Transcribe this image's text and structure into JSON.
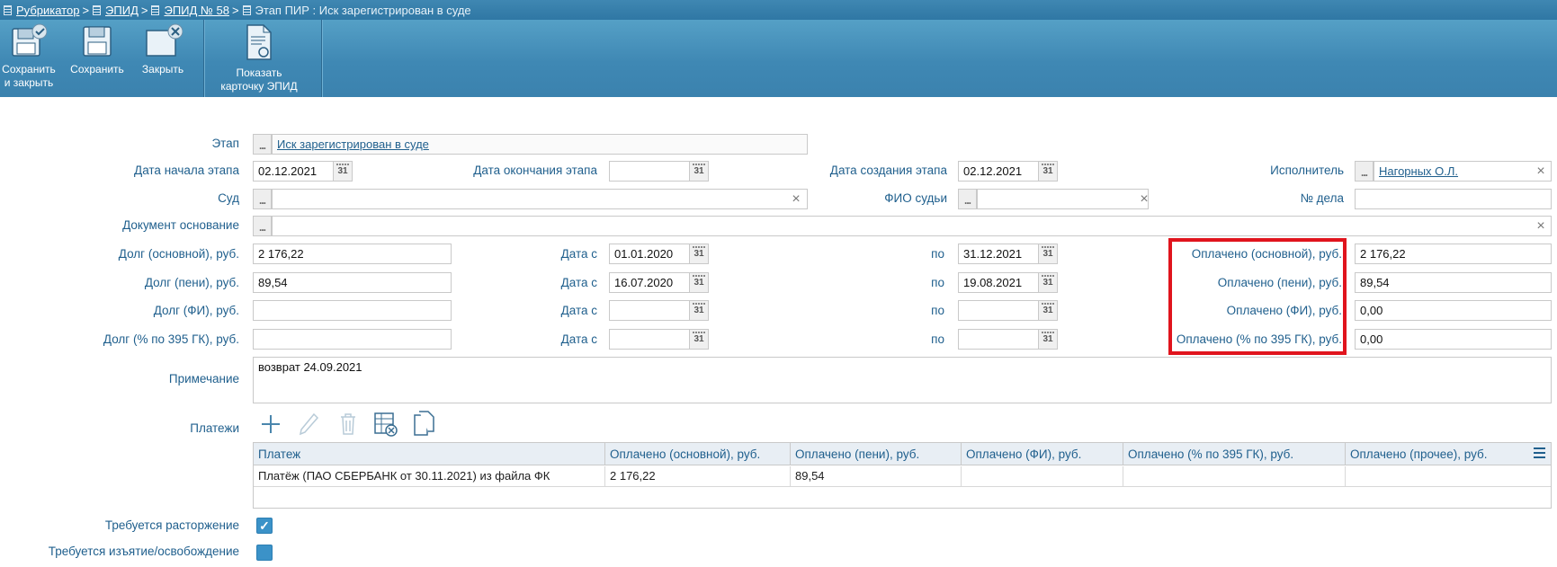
{
  "breadcrumb": {
    "items": [
      "Рубрикатор",
      "ЭПИД",
      "ЭПИД № 58"
    ],
    "current": "Этап ПИР : Иск зарегистрирован в суде",
    "separator": ">"
  },
  "toolbar": {
    "save_close": {
      "line1": "Сохранить",
      "line2": "и закрыть"
    },
    "save": "Сохранить",
    "close": "Закрыть",
    "show_card": {
      "line1": "Показать",
      "line2": "карточку ЭПИД"
    }
  },
  "form": {
    "stage_label": "Этап",
    "stage_value": "Иск зарегистрирован в суде",
    "start_date_label": "Дата начала этапа",
    "start_date": "02.12.2021",
    "end_date_label": "Дата окончания этапа",
    "end_date": "",
    "created_date_label": "Дата создания этапа",
    "created_date": "02.12.2021",
    "executor_label": "Исполнитель",
    "executor": "Нагорных О.Л.",
    "court_label": "Суд",
    "court": "",
    "judge_label": "ФИО судьи",
    "judge": "",
    "case_no_label": "№ дела",
    "case_no": "",
    "doc_basis_label": "Документ основание",
    "doc_basis": "",
    "date_from_label": "Дата с",
    "date_to_label": "по",
    "debt_rows": [
      {
        "label": "Долг (основной), руб.",
        "value": "2 176,22",
        "from": "01.01.2020",
        "to": "31.12.2021",
        "paid_label": "Оплачено (основной), руб.",
        "paid": "2 176,22"
      },
      {
        "label": "Долг (пени), руб.",
        "value": "89,54",
        "from": "16.07.2020",
        "to": "19.08.2021",
        "paid_label": "Оплачено (пени), руб.",
        "paid": "89,54"
      },
      {
        "label": "Долг (ФИ), руб.",
        "value": "",
        "from": "",
        "to": "",
        "paid_label": "Оплачено (ФИ), руб.",
        "paid": "0,00"
      },
      {
        "label": "Долг (% по 395 ГК), руб.",
        "value": "",
        "from": "",
        "to": "",
        "paid_label": "Оплачено (% по 395 ГК), руб.",
        "paid": "0,00"
      }
    ],
    "note_label": "Примечание",
    "note": "возврат 24.09.2021",
    "payments_label": "Платежи",
    "termination_label": "Требуется расторжение",
    "termination_checked": true,
    "seizure_label": "Требуется изъятие/освобождение",
    "seizure_checked": false
  },
  "payments_table": {
    "columns": [
      "Платеж",
      "Оплачено (основной), руб.",
      "Оплачено (пени), руб.",
      "Оплачено (ФИ), руб.",
      "Оплачено (% по 395 ГК), руб.",
      "Оплачено (прочее), руб."
    ],
    "rows": [
      [
        "Платёж (ПАО СБЕРБАНК от 30.11.2021) из файла ФК",
        "2 176,22",
        "89,54",
        "",
        "",
        ""
      ]
    ]
  },
  "icons": {
    "date_button": "31",
    "dots": "..."
  },
  "colors": {
    "accent": "#3f88b4",
    "label": "#1f5f8d",
    "highlight": "#e0141d"
  }
}
